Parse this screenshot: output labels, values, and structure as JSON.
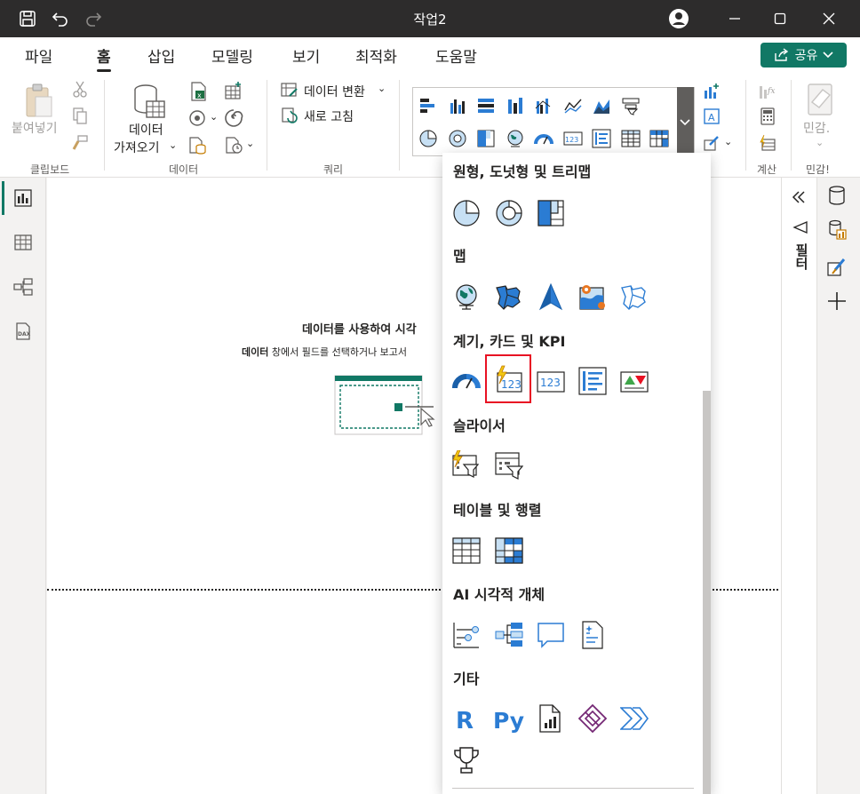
{
  "window": {
    "title": "작업2"
  },
  "menu": {
    "tabs": [
      {
        "label": "파일"
      },
      {
        "label": "홈"
      },
      {
        "label": "삽입"
      },
      {
        "label": "모델링"
      },
      {
        "label": "보기"
      },
      {
        "label": "최적화"
      },
      {
        "label": "도움말"
      }
    ],
    "share_label": "공유"
  },
  "ribbon": {
    "clipboard": {
      "paste_label": "붙여넣기",
      "group_label": "클립보드"
    },
    "data": {
      "get_data_line1": "데이터",
      "get_data_line2": "가져오기",
      "group_label": "데이터"
    },
    "query": {
      "transform_label": "데이터 변환",
      "refresh_label": "새로 고침",
      "group_label": "쿼리"
    },
    "calc": {
      "group_label": "계산"
    },
    "sensitivity": {
      "label": "민감.",
      "group_label": "민감!"
    }
  },
  "canvas": {
    "title": "데이터를 사용하여 시각",
    "subtitle_bold": "데이터",
    "subtitle_rest": " 창에서 필드를 선택하거나 보고서"
  },
  "filter_pane": {
    "label": "필터"
  },
  "dropdown": {
    "sections": [
      {
        "heading": "원형, 도넛형 및 트리맵"
      },
      {
        "heading": "맵"
      },
      {
        "heading": "계기, 카드 및 KPI"
      },
      {
        "heading": "슬라이서"
      },
      {
        "heading": "테이블 및 행렬"
      },
      {
        "heading": "AI 시각적 개체"
      },
      {
        "heading": "기타"
      }
    ],
    "other_visuals": {
      "r_label": "R",
      "py_label": "Py"
    },
    "card_number_label": "123"
  },
  "colors": {
    "accent": "#117865",
    "titlebar": "#2d2c2c",
    "icon_blue": "#2b7cd3",
    "highlight": "#e81123"
  }
}
